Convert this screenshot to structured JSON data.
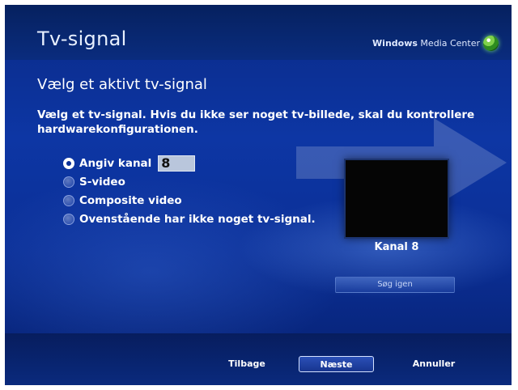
{
  "header": {
    "title": "Tv-signal",
    "brand_bold": "Windows",
    "brand_rest": " Media Center",
    "brand_logo_icon": "windows-flag-icon"
  },
  "main": {
    "heading": "Vælg et aktivt tv-signal",
    "description": "Vælg et tv-signal. Hvis du ikke ser noget tv-billede, skal du kontrollere hardwarekonfigurationen.",
    "options": [
      {
        "label": "Angiv kanal",
        "checked": true
      },
      {
        "label": "S-video",
        "checked": false
      },
      {
        "label": "Composite video",
        "checked": false
      },
      {
        "label": "Ovenstående har ikke noget tv-signal.",
        "checked": false
      }
    ],
    "channel_value": "8",
    "preview_label": "Kanal 8",
    "rescan_label": "Søg igen"
  },
  "footer": {
    "back_label": "Tilbage",
    "next_label": "Næste",
    "cancel_label": "Annuller"
  },
  "colors": {
    "background": "#0d36a4",
    "header": "#06215f",
    "text": "#ffffff",
    "accent": "#7fd24a"
  }
}
